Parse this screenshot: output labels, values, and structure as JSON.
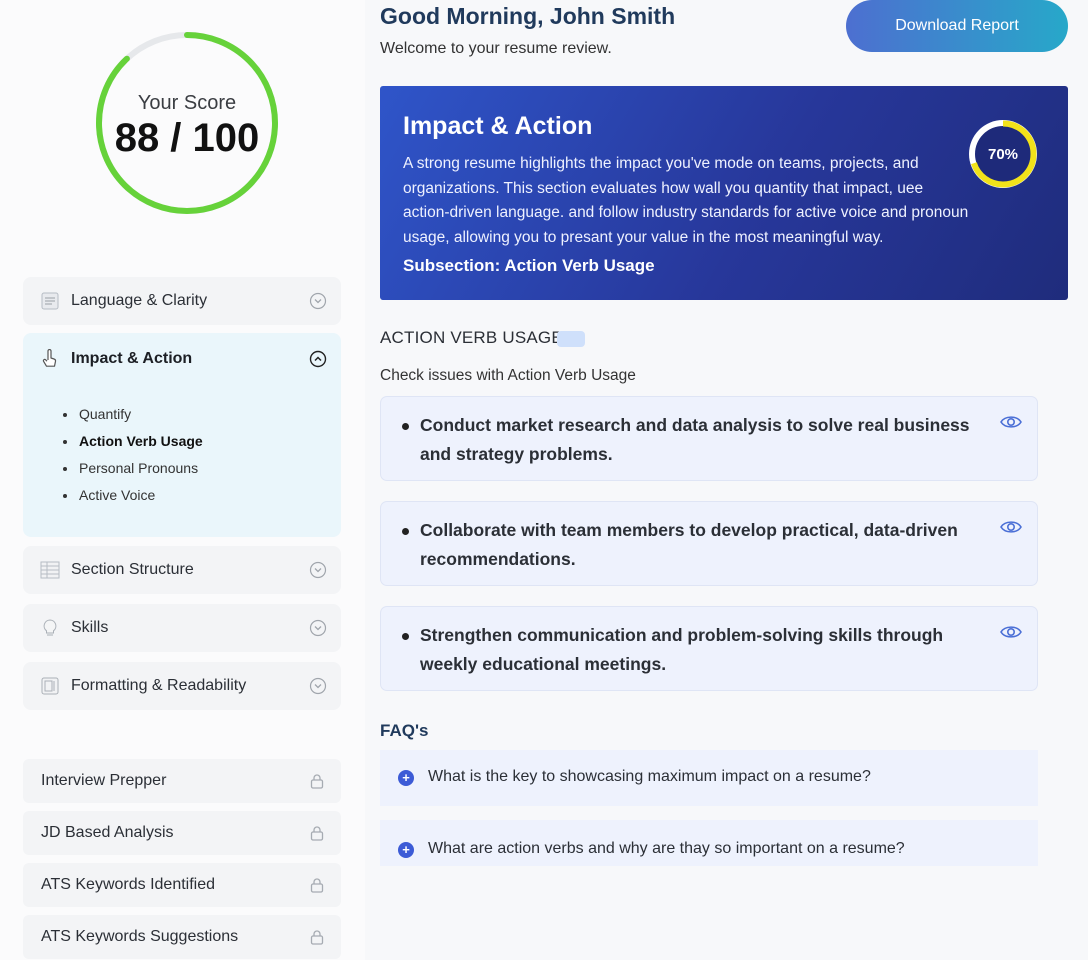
{
  "score": {
    "label": "Your Score",
    "value": "88 / 100",
    "fraction": 0.88,
    "ring_color": "#66d23a",
    "track_color": "#e6e8eb"
  },
  "sidebar": {
    "items": [
      {
        "label": "Language & Clarity",
        "icon": "document-icon"
      },
      {
        "label": "Impact & Action",
        "icon": "hand-pointer-icon",
        "expanded": true,
        "subitems": [
          "Quantify",
          "Action Verb Usage",
          "Personal Pronouns",
          "Active Voice"
        ],
        "active_subitem": "Action Verb Usage"
      },
      {
        "label": "Section Structure",
        "icon": "table-icon"
      },
      {
        "label": "Skills",
        "icon": "lightbulb-icon"
      },
      {
        "label": "Formatting & Readability",
        "icon": "layout-icon"
      }
    ],
    "locked": [
      {
        "label": "Interview Prepper"
      },
      {
        "label": "JD Based Analysis"
      },
      {
        "label": "ATS Keywords Identified"
      },
      {
        "label": "ATS Keywords Suggestions"
      }
    ]
  },
  "header": {
    "greeting": "Good Morning, John Smith",
    "welcome": "Welcome to your resume review.",
    "download_label": "Download Report"
  },
  "banner": {
    "title": "Impact & Action",
    "description": "A strong resume highlights the impact you've mode on teams, projects, and organizations. This section evaluates how wall you quantity that impact, uee action-driven language. and follow industry standards for active voice and pronoun usage, allowing you to presant your value in the most meaningful way.",
    "subsection": "Subsection: Action Verb Usage",
    "percent_label": "70%",
    "percent": 0.7,
    "ring_color": "#f2e21a"
  },
  "section": {
    "title": "ACTION VERB USAGE",
    "description": "Check issues with Action Verb Usage"
  },
  "issues": [
    {
      "text": "Conduct market research and data analysis to solve real business and strategy problems."
    },
    {
      "text": "Collaborate with team members to develop practical, data-driven recommendations."
    },
    {
      "text": "Strengthen communication and problem-solving skills through weekly educational meetings."
    }
  ],
  "faq": {
    "heading": "FAQ's",
    "items": [
      {
        "question": "What is the key to showcasing maximum impact on a resume?"
      },
      {
        "question": "What are action verbs and why are thay so important on a resume?"
      }
    ]
  }
}
